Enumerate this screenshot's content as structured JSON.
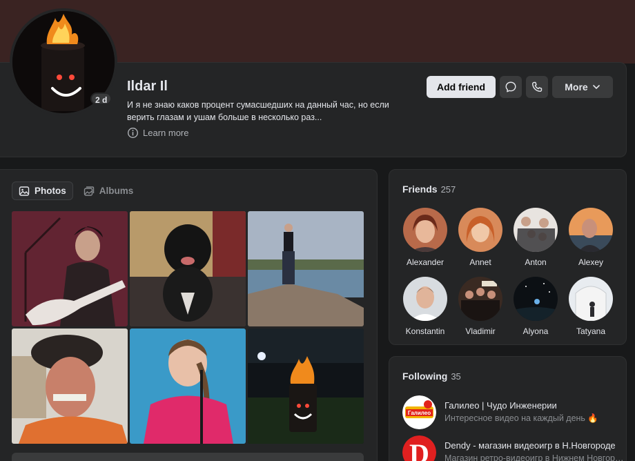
{
  "profile": {
    "name": "Ildar Il",
    "bio": "И я не знаю каков процент сумасшедших на данный час, но если верить глазам и ушам больше в несколько раз...",
    "status_badge": "2 d",
    "learn_more": "Learn more"
  },
  "actions": {
    "add_friend": "Add friend",
    "more": "More"
  },
  "photos": {
    "tabs": [
      {
        "label": "Photos",
        "active": true
      },
      {
        "label": "Albums",
        "active": false
      }
    ]
  },
  "friends": {
    "title": "Friends",
    "count": "257",
    "items": [
      {
        "name": "Alexander"
      },
      {
        "name": "Annet"
      },
      {
        "name": "Anton"
      },
      {
        "name": "Alexey"
      },
      {
        "name": "Konstantin"
      },
      {
        "name": "Vladimir"
      },
      {
        "name": "Alyona"
      },
      {
        "name": "Tatyana"
      }
    ]
  },
  "following": {
    "title": "Following",
    "count": "35",
    "items": [
      {
        "name": "Галилео | Чудо Инженерии",
        "desc": "Интересное видео на каждый день 🔥",
        "logo_text": "Галилео"
      },
      {
        "name": "Dendy - магазин видеоигр в Н.Новгороде",
        "desc": "Магазин ретро-видеоигр в Нижнем Новгороде",
        "logo_text": "D"
      }
    ]
  },
  "colors": {
    "background": "#18191a",
    "card": "#242526",
    "cover": "#3a2322",
    "button_primary": "#e4e6eb",
    "button_secondary": "#3a3b3c"
  }
}
